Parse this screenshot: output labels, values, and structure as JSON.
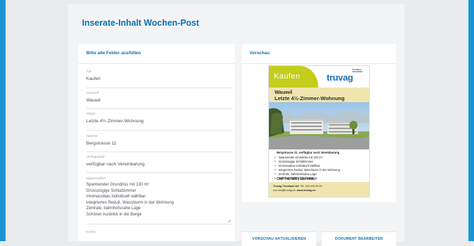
{
  "page": {
    "title": "Inserate-Inhalt Wochen-Post",
    "accent_color": "#0c6fab",
    "frame_color": "#1a93d3"
  },
  "form": {
    "header": "Bitte alle Felder ausfüllen",
    "fields": [
      {
        "label": "Typ",
        "value": "Kaufen"
      },
      {
        "label": "Ortschaft",
        "value": "Wauwil"
      },
      {
        "label": "Objekt",
        "value": "Letzte 4½-Zimmer-Wohnung"
      },
      {
        "label": "Adresse",
        "value": "Bergstrasse 11"
      },
      {
        "label": "Verfügbarkeit",
        "value": "verfügbar nach Vereinbarung"
      }
    ],
    "properties": {
      "label": "Eigenschaften",
      "lines": [
        "Spannender Grundriss mit 130 m²",
        "Grosszügige Schlafzimmer",
        "Innenausbau individuell wählbar",
        "integriertes Reduit, Waschturm in der Wohnung",
        "Zentrale, bahnhofsnahe Lage",
        "Schöner Ausblick in die Berge"
      ]
    },
    "next_field_label": "Kosten"
  },
  "preview": {
    "header": "Vorschau",
    "ad": {
      "type_label": "Kaufen",
      "type_color": "#c4cd1c",
      "brand": "truvag",
      "brand_tag_1": "Treuhand",
      "brand_tag_2": "Immobilien",
      "brand_color": "#1b6fb0",
      "band_color": "#f0e5ae",
      "title_line_1": "Wauwil",
      "title_line_2": "Letzte 4½-Zimmer-Wohnung",
      "address_line": "Bergstrasse 11, verfügbar nach Vereinbarung",
      "bullets": [
        "Spannender Grundriss mit 130 m²",
        "Grosszügige Schlafzimmer",
        "Innenausbau individuell wählbar",
        "Integriertes Reduit, Waschturm in der Wohnung",
        "Zentrale, bahnhofsnahe Lage",
        "Schöner Ausblick in die Berge"
      ],
      "price": "CHF 740'000 | 160 HNK",
      "footer_company": "Truvag Treuhand AG",
      "footer_phone": ", Tel. 000 000 00 00",
      "footer_email": "xxx.xxx@truvag.ch",
      "footer_web": "www.truvag.ch"
    }
  },
  "actions": {
    "refresh_label": "VORSCHAU AKTUALISIEREN",
    "edit_label": "DOKUMENT BEARBEITEN"
  }
}
